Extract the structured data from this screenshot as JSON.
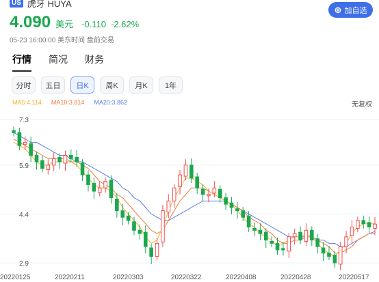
{
  "header": {
    "market_badge": "US",
    "name": "虎牙 HUYA",
    "add_watchlist_label": "加自选",
    "price": "4.090",
    "currency": "美元",
    "change": "-0.110",
    "change_pct": "-2.62%",
    "timestamp": "05-23 16:00:00 美东时间 盘前交易",
    "colors": {
      "down": "#1aa84e",
      "up": "#f34b4b",
      "accent": "#3f6fe8"
    }
  },
  "tabs": [
    "行情",
    "简况",
    "财务"
  ],
  "periods": [
    "分时",
    "五日",
    "日K",
    "周K",
    "月K",
    "1年"
  ],
  "selected_period": "日K",
  "ma": {
    "ma5": "MA5:4.114",
    "ma10": "MA10:3.814",
    "ma20": "MA20:3.862"
  },
  "adjust_label": "无复权",
  "chart_data": {
    "type": "candlestick",
    "y_ticks": [
      "7.3",
      "5.9",
      "4.4",
      "2.9"
    ],
    "x_ticks": [
      "20220125",
      "20220211",
      "20220303",
      "20220322",
      "20220408",
      "20220428",
      "20220517"
    ],
    "close_series": [
      6.9,
      6.5,
      6.6,
      6.2,
      6.0,
      5.8,
      5.9,
      6.1,
      6.0,
      6.2,
      6.1,
      6.0,
      5.6,
      5.3,
      5.1,
      5.2,
      5.4,
      4.9,
      4.5,
      4.3,
      4.2,
      3.9,
      3.8,
      3.4,
      3.1,
      3.5,
      4.5,
      4.8,
      5.2,
      5.6,
      5.9,
      5.5,
      5.2,
      5.0,
      5.0,
      5.2,
      4.9,
      4.7,
      4.6,
      4.5,
      4.3,
      4.0,
      3.9,
      3.8,
      3.6,
      3.5,
      3.3,
      3.3,
      3.7,
      3.8,
      3.6,
      3.9,
      3.6,
      3.4,
      3.2,
      3.1,
      2.9,
      3.4,
      3.7,
      4.0,
      4.2,
      4.1,
      4.0,
      4.09
    ],
    "ma5": [
      6.6,
      6.5,
      6.4,
      6.2,
      6.0,
      5.9,
      5.9,
      6.0,
      6.0,
      6.0,
      6.0,
      5.9,
      5.7,
      5.5,
      5.3,
      5.2,
      5.2,
      5.1,
      4.9,
      4.6,
      4.4,
      4.2,
      4.0,
      3.7,
      3.5,
      3.6,
      4.0,
      4.5,
      4.9,
      5.2,
      5.5,
      5.5,
      5.4,
      5.3,
      5.1,
      5.0,
      4.9,
      4.8,
      4.7,
      4.5,
      4.3,
      4.1,
      4.0,
      3.8,
      3.7,
      3.6,
      3.4,
      3.5,
      3.6,
      3.7,
      3.7,
      3.8,
      3.7,
      3.5,
      3.3,
      3.2,
      3.1,
      3.3,
      3.5,
      3.8,
      4.0,
      4.1,
      4.1,
      4.1
    ],
    "ma10": [
      6.7,
      6.6,
      6.5,
      6.4,
      6.3,
      6.2,
      6.1,
      6.1,
      6.1,
      6.1,
      6.0,
      6.0,
      5.9,
      5.8,
      5.6,
      5.4,
      5.3,
      5.2,
      5.0,
      4.9,
      4.7,
      4.5,
      4.3,
      4.1,
      3.9,
      3.8,
      3.9,
      4.2,
      4.5,
      4.8,
      5.0,
      5.2,
      5.2,
      5.2,
      5.1,
      5.0,
      4.9,
      4.8,
      4.7,
      4.6,
      4.5,
      4.3,
      4.2,
      4.1,
      3.9,
      3.8,
      3.6,
      3.5,
      3.5,
      3.6,
      3.6,
      3.7,
      3.7,
      3.6,
      3.5,
      3.4,
      3.2,
      3.2,
      3.3,
      3.4,
      3.6,
      3.7,
      3.8,
      3.81
    ],
    "ma20": [
      6.9,
      6.8,
      6.7,
      6.6,
      6.6,
      6.5,
      6.4,
      6.3,
      6.2,
      6.2,
      6.1,
      6.0,
      6.0,
      5.9,
      5.8,
      5.7,
      5.6,
      5.5,
      5.4,
      5.2,
      5.1,
      4.9,
      4.8,
      4.6,
      4.4,
      4.3,
      4.2,
      4.2,
      4.3,
      4.4,
      4.5,
      4.6,
      4.7,
      4.8,
      4.8,
      4.8,
      4.8,
      4.8,
      4.7,
      4.6,
      4.5,
      4.4,
      4.3,
      4.2,
      4.1,
      4.0,
      3.9,
      3.8,
      3.7,
      3.7,
      3.7,
      3.7,
      3.7,
      3.6,
      3.6,
      3.5,
      3.5,
      3.4,
      3.4,
      3.5,
      3.6,
      3.7,
      3.8,
      3.86
    ]
  }
}
